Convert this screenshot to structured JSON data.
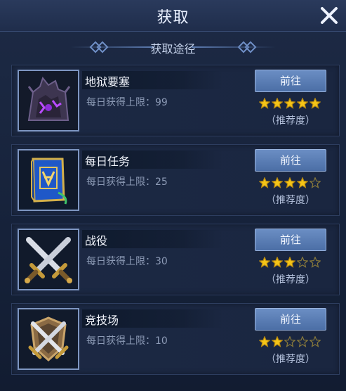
{
  "header": {
    "title": "获取"
  },
  "subheader": {
    "title": "获取途径"
  },
  "sources": [
    {
      "name": "地狱要塞",
      "limit_text": "每日获得上限：99",
      "button": "前往",
      "rating": 5,
      "rec_label": "（推荐度）",
      "icon": "hell-fortress-icon"
    },
    {
      "name": "每日任务",
      "limit_text": "每日获得上限：25",
      "button": "前往",
      "rating": 4,
      "rec_label": "（推荐度）",
      "icon": "quest-book-icon"
    },
    {
      "name": "战役",
      "limit_text": "每日获得上限：30",
      "button": "前往",
      "rating": 3,
      "rec_label": "（推荐度）",
      "icon": "crossed-swords-icon"
    },
    {
      "name": "竞技场",
      "limit_text": "每日获得上限：10",
      "button": "前往",
      "rating": 2,
      "rec_label": "（推荐度）",
      "icon": "arena-shield-icon"
    }
  ],
  "colors": {
    "star_filled": "#f5c518",
    "star_empty": "#8a7a3a",
    "button": "#5b7eb6"
  }
}
